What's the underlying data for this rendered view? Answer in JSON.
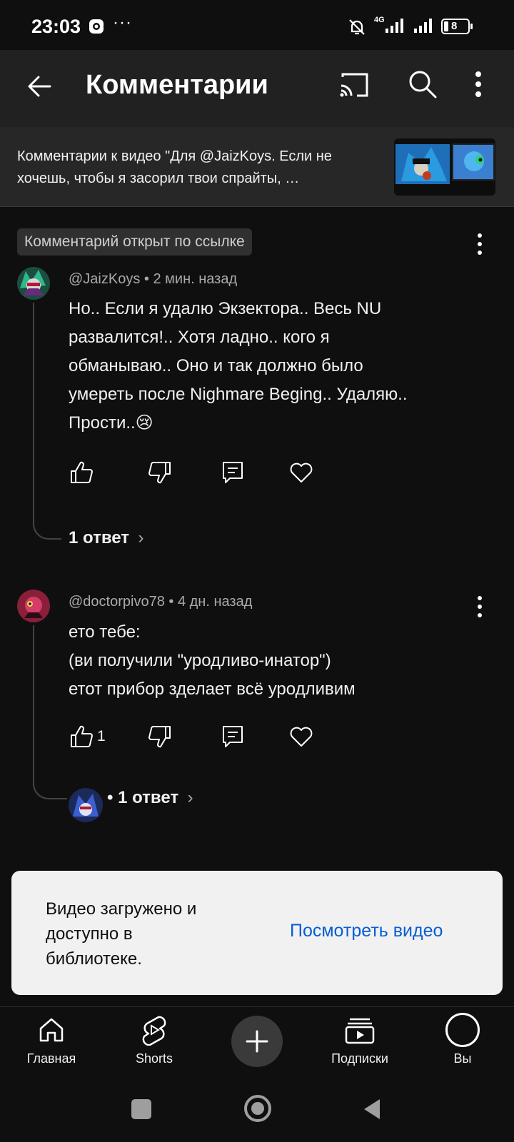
{
  "status_bar": {
    "time": "23:03",
    "battery": "8",
    "network": "4G"
  },
  "header": {
    "title": "Комментарии"
  },
  "video": {
    "text": "Комментарии к видео \"Для @JaizKoys. Если не хочешь, чтобы я засорил твои спрайты, …"
  },
  "link_badge": "Комментарий открыт по ссылке",
  "comments": [
    {
      "author": "@JaizKoys",
      "time": "2 мин. назад",
      "text_lines": [
        "Но.. Если я удалю Экзектора.. Весь NU",
        "развалится!.. Хотя ладно.. кого я",
        "обманываю.. Оно и так должно было",
        "умереть после Nighmare Beging.. Удаляю..",
        "Прости..😢"
      ],
      "likes": "",
      "replies": "1 ответ"
    },
    {
      "author": "@doctorpivo78",
      "time": "4 дн. назад",
      "text_lines": [
        "ето тебе:",
        "(ви получили \"уродливо-инатор\")",
        "етот прибор зделает всё уродливим"
      ],
      "likes": "1",
      "replies": "1 ответ"
    }
  ],
  "snackbar": {
    "text": "Видео загружено и доступно в библиотеке.",
    "action": "Посмотреть видео"
  },
  "bottom_nav": {
    "home": "Главная",
    "shorts": "Shorts",
    "subscriptions": "Подписки",
    "you": "Вы"
  },
  "colors": {
    "background": "#0f0f0f",
    "header": "#212121",
    "accent_link": "#065fd4",
    "snackbar": "#f1f1f1"
  },
  "icons": [
    "back-arrow-icon",
    "cast-icon",
    "search-icon",
    "more-vert-icon",
    "like-icon",
    "dislike-icon",
    "reply-icon",
    "heart-icon",
    "home-icon",
    "shorts-icon",
    "plus-icon",
    "subscriptions-icon",
    "profile-icon"
  ]
}
